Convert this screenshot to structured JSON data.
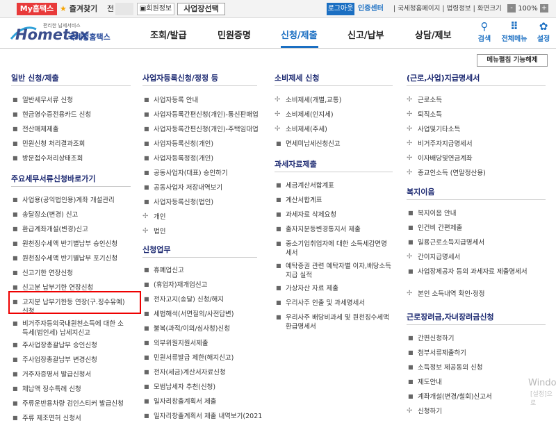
{
  "topbar": {
    "my_home": "My홈택스",
    "favorites": "즐겨찾기",
    "jeon": "전",
    "member_info": "회원정보",
    "business_select": "사업장선택",
    "logout": "로그아웃",
    "auth_center": "인증센터",
    "links": "| 국세청홈페이지 | 법령정보 | 화면크기",
    "zoom_minus": "-",
    "zoom_value": "100%",
    "zoom_plus": "+"
  },
  "header": {
    "logo_main": "Hometax",
    "logo_small": "편리한 납세서비스",
    "logo_ko": "국세청홈택스",
    "nav": [
      "조회/발급",
      "민원증명",
      "신청/제출",
      "신고/납부",
      "상담/제보"
    ],
    "active_nav": "신청/제출",
    "icons": [
      {
        "name": "search-icon",
        "label": "검색",
        "glyph": "⚲"
      },
      {
        "name": "all-menu-icon",
        "label": "전체메뉴",
        "glyph": "⠿"
      },
      {
        "name": "settings-icon",
        "label": "설정",
        "glyph": "✿"
      }
    ]
  },
  "menu_fix_button": "메뉴펼침 기능해제",
  "col1": {
    "sec1": "일반 신청/제출",
    "sec1_items": [
      "일반세무서류 신청",
      "현금영수증전용카드 신청",
      "전산매체제출",
      "민원신청 처리결과조회",
      "방문접수처리상태조회"
    ],
    "sec2": "주요세무서류신청바로가기",
    "sec2_items": [
      "사업용(공익법인용)계좌 개설관리",
      "송달장소(변경) 신고",
      "환급계좌개설(변경)신고",
      "원천징수세액 반기별납부 승인신청",
      "원천징수세액 반기별납부 포기신청",
      "신고기한 연장신청",
      "신고분 납부기한 연장신청",
      "고지분 납부기한등 연장(구.징수유예) 신청",
      "비거주자등의국내원천소득에 대한 소득세(법인세) 납세지신고",
      "주사업장총괄납부 승인신청",
      "주사업장총괄납부 변경신청",
      "거주자증명서 발급신청서",
      "체납액 징수특례 신청",
      "주류운반용차량 검인스티커 발급신청",
      "주류 제조면허 신청서"
    ]
  },
  "col2": {
    "sec1": "사업자등록신청/정정 등",
    "sec1_items": [
      {
        "label": "사업자등록 안내",
        "icon": "bullet"
      },
      {
        "label": "사업자등록간편신청(개인)-통신판매업",
        "icon": "bullet"
      },
      {
        "label": "사업자등록간편신청(개인)-주택임대업",
        "icon": "bullet"
      },
      {
        "label": "사업자등록신청(개인)",
        "icon": "bullet"
      },
      {
        "label": "사업자등록정정(개인)",
        "icon": "bullet"
      },
      {
        "label": "공동사업자(대표) 승인하기",
        "icon": "bullet"
      },
      {
        "label": "공동사업자 저장내역보기",
        "icon": "bullet"
      },
      {
        "label": "사업자등록신청(법인)",
        "icon": "bullet"
      },
      {
        "label": "개인",
        "icon": "plus"
      },
      {
        "label": "법인",
        "icon": "plus"
      }
    ],
    "sec2": "신청업무",
    "sec2_items": [
      "휴폐업신고",
      "(휴업자)재개업신고",
      "전자고지(송달) 신청/해지",
      "세법해석(서면질의/사전답변)",
      "불복(과적/이의/심사청)신청",
      "외부위원지원서제출",
      "민원서류발급 제한(해지신고)",
      "전자(세금)계산서자료신청",
      "모범납세자 추천(신청)",
      "일자리창출계획서 제출",
      "일자리창출계획서 제출 내역보기(2021"
    ]
  },
  "col3": {
    "sec1": "소비제세 신청",
    "sec1_items": [
      {
        "label": "소비제세(개별,교통)",
        "icon": "plus"
      },
      {
        "label": "소비제세(인지세)",
        "icon": "plus"
      },
      {
        "label": "소비제세(주세)",
        "icon": "plus"
      },
      {
        "label": "면세미납세신청신고",
        "icon": "bullet"
      }
    ],
    "sec2": "과세자료제출",
    "sec2_items": [
      "세금계산서합계표",
      "계산서합계표",
      "과세자료 삭제요청",
      "출자지분등변경통지서 제출",
      "중소기업취업자에 대한 소득세감면명세서",
      "예탁증권 관련 예탁자별 이자,배당소득지급 실적",
      "가상자산 자료 제출",
      "우리사주 인출 및 과세명세서",
      "우리사주 배당비과세 및 원천징수세액환급명세서"
    ]
  },
  "col4": {
    "sec1": "(근로,사업)지급명세서",
    "sec1_items": [
      {
        "label": "근로소득",
        "icon": "plus"
      },
      {
        "label": "퇴직소득",
        "icon": "plus"
      },
      {
        "label": "사업및기타소득",
        "icon": "plus"
      },
      {
        "label": "비거주자지급명세서",
        "icon": "plus"
      },
      {
        "label": "이자배당및연금계좌",
        "icon": "plus"
      },
      {
        "label": "종교인소득 (연말정산용)",
        "icon": "plus"
      }
    ],
    "sec2": "복지이음",
    "sec2_items": [
      {
        "label": "복지이음 안내",
        "icon": "bullet"
      },
      {
        "label": "인건비 간편제출",
        "icon": "bullet"
      },
      {
        "label": "일용근로소득지급명세서",
        "icon": "bullet"
      },
      {
        "label": "간이지급명세서",
        "icon": "plus"
      },
      {
        "label": "사업장제공자 등의 과세자료 제출명세서",
        "icon": "bullet"
      },
      {
        "label": "본인 소득내역 확인·정정",
        "icon": "plus"
      }
    ],
    "sec3": "근로장려금,자녀장려금신청",
    "sec3_items": [
      {
        "label": "간편신청하기",
        "icon": "bullet"
      },
      {
        "label": "첨부서류제출하기",
        "icon": "bullet"
      },
      {
        "label": "소득정보 제공동의 신청",
        "icon": "bullet"
      },
      {
        "label": "제도안내",
        "icon": "bullet"
      },
      {
        "label": "계좌개설(변경/철회)신고서",
        "icon": "bullet"
      },
      {
        "label": "신청하기",
        "icon": "plus"
      }
    ]
  },
  "watermark": {
    "line1": "Windo",
    "line2": "[설정]으로"
  }
}
